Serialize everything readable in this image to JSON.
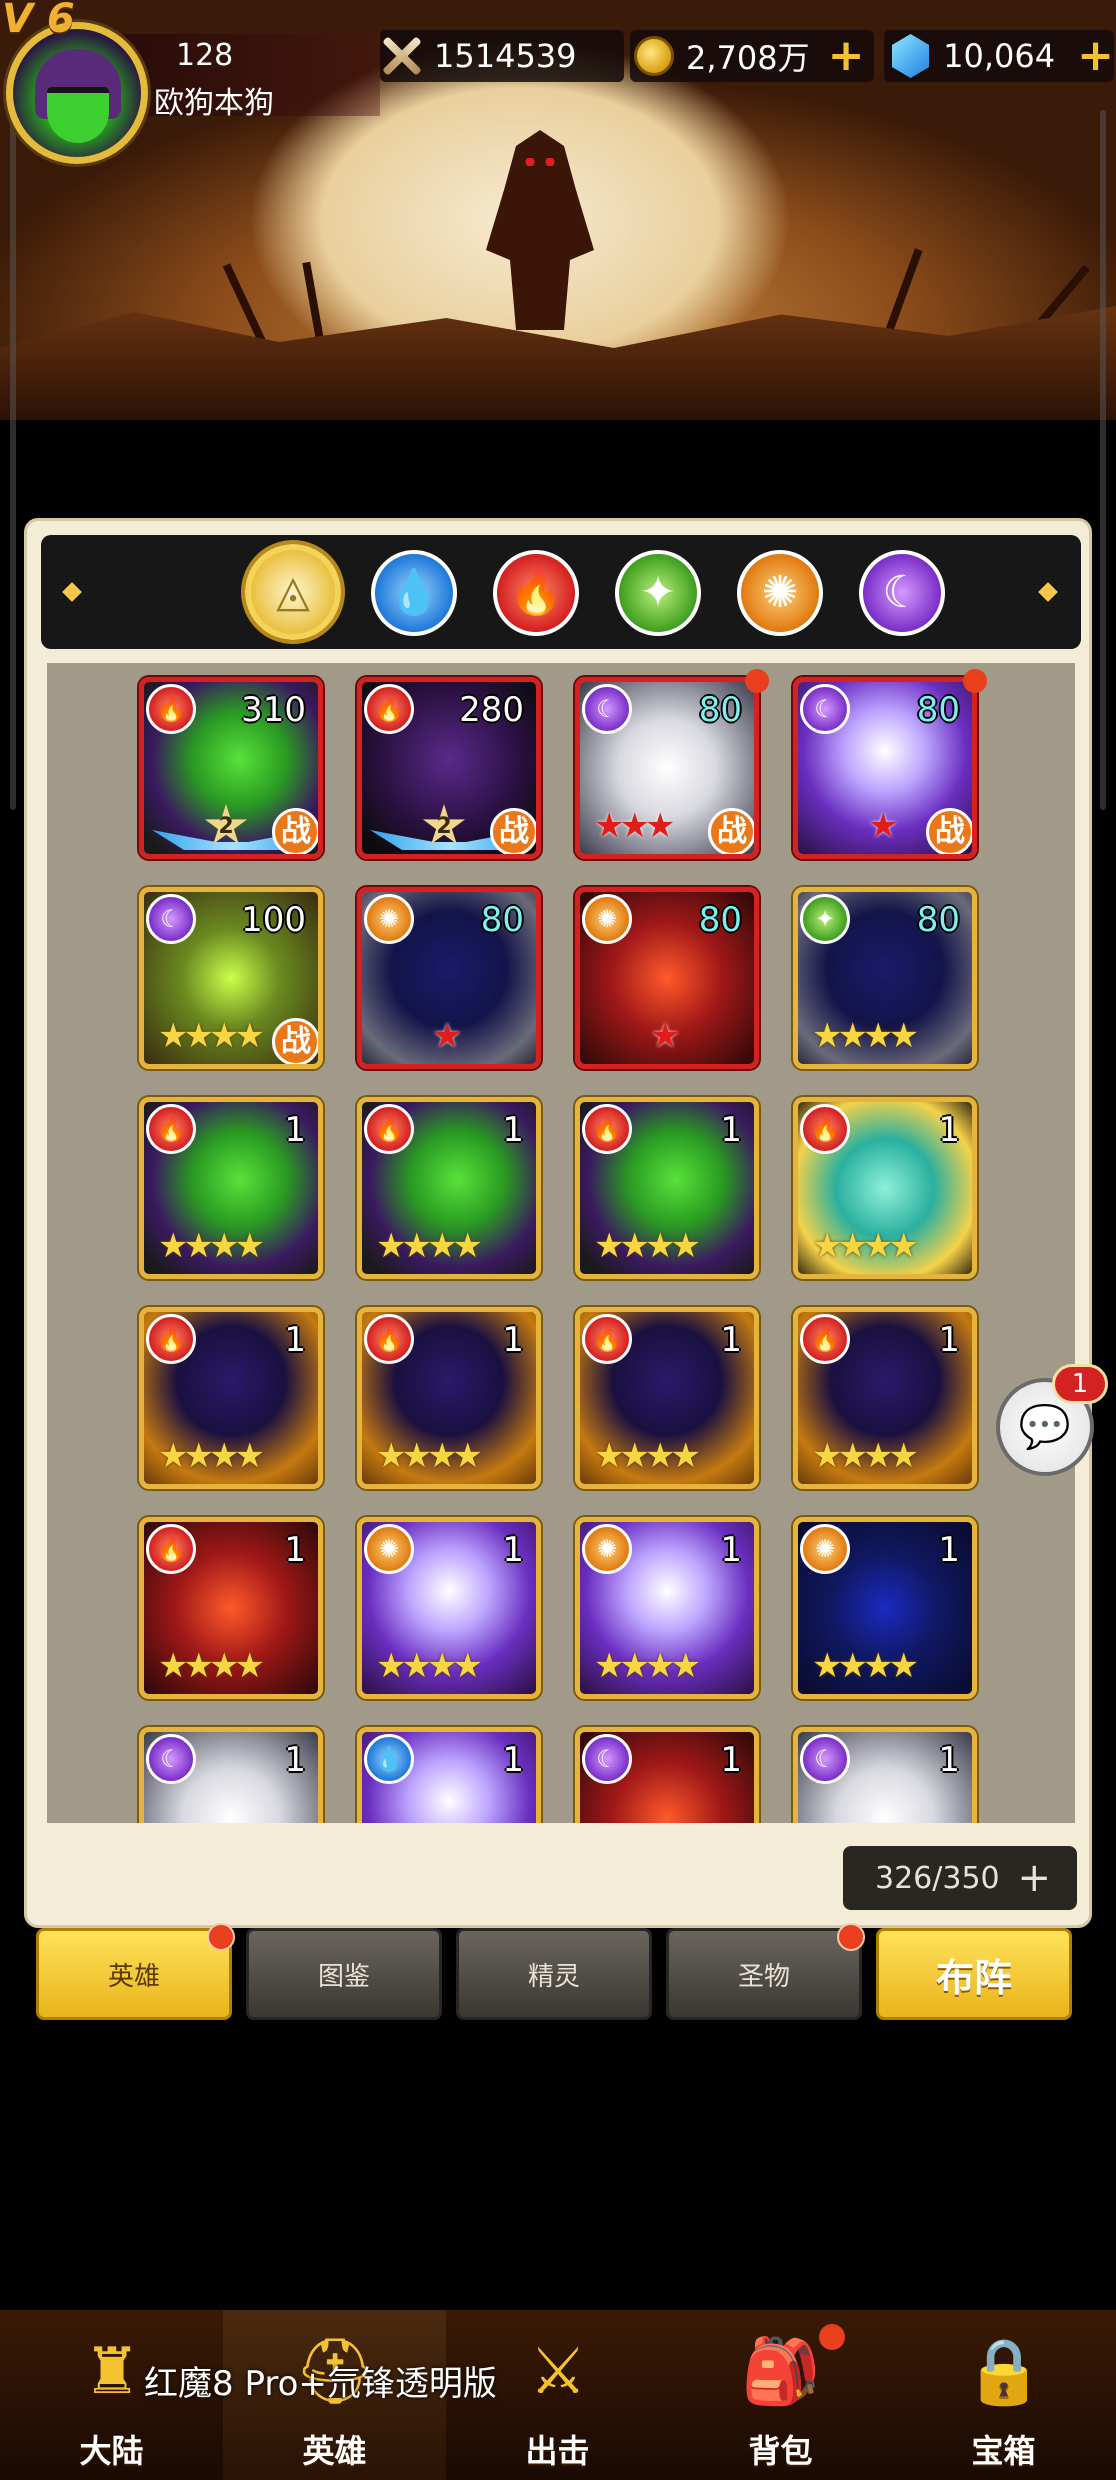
{
  "top_bar": {
    "vip_label": "V 6",
    "level": "128",
    "player_name": "欧狗本狗",
    "power": "1514539",
    "gold": "2,708万",
    "gems": "10,064",
    "plus_symbol": "+"
  },
  "element_filters": [
    {
      "name": "all",
      "icon": "◬",
      "selected": true
    },
    {
      "name": "water",
      "icon": "💧",
      "selected": false
    },
    {
      "name": "fire",
      "icon": "🔥",
      "selected": false
    },
    {
      "name": "wind",
      "icon": "✦",
      "selected": false
    },
    {
      "name": "sun",
      "icon": "✺",
      "selected": false
    },
    {
      "name": "moon",
      "icon": "☾",
      "selected": false
    }
  ],
  "element_icons": {
    "fire": "🔥",
    "moon": "☾",
    "sun": "✺",
    "wind": "✦",
    "water": "💧"
  },
  "heroes": [
    {
      "element": "fire",
      "level": "310",
      "stars": 2,
      "star_style": "rank",
      "in_battle": true,
      "frame": "red",
      "art": "g-green",
      "red_dot": false
    },
    {
      "element": "fire",
      "level": "280",
      "stars": 2,
      "star_style": "rank",
      "in_battle": true,
      "frame": "red",
      "art": "g-black",
      "red_dot": false
    },
    {
      "element": "moon",
      "level": "80",
      "stars": 3,
      "star_style": "red",
      "in_battle": true,
      "frame": "red",
      "art": "g-white",
      "red_dot": true
    },
    {
      "element": "moon",
      "level": "80",
      "stars": 1,
      "star_style": "red",
      "in_battle": true,
      "frame": "red",
      "art": "g-purple",
      "red_dot": true
    },
    {
      "element": "moon",
      "level": "100",
      "stars": 4,
      "star_style": "gold",
      "in_battle": true,
      "frame": "gold",
      "art": "g-yellowgreen",
      "red_dot": false
    },
    {
      "element": "sun",
      "level": "80",
      "stars": 1,
      "star_style": "red",
      "in_battle": false,
      "frame": "red",
      "art": "g-navy",
      "red_dot": false
    },
    {
      "element": "sun",
      "level": "80",
      "stars": 1,
      "star_style": "red",
      "in_battle": false,
      "frame": "red",
      "art": "g-red",
      "red_dot": false
    },
    {
      "element": "wind",
      "level": "80",
      "stars": 4,
      "star_style": "gold",
      "in_battle": false,
      "frame": "gold",
      "art": "g-navy",
      "red_dot": false
    },
    {
      "element": "fire",
      "level": "1",
      "stars": 4,
      "star_style": "gold",
      "in_battle": false,
      "frame": "gold",
      "art": "g-green",
      "red_dot": false
    },
    {
      "element": "fire",
      "level": "1",
      "stars": 4,
      "star_style": "gold",
      "in_battle": false,
      "frame": "gold",
      "art": "g-green",
      "red_dot": false
    },
    {
      "element": "fire",
      "level": "1",
      "stars": 4,
      "star_style": "gold",
      "in_battle": false,
      "frame": "gold",
      "art": "g-green",
      "red_dot": false
    },
    {
      "element": "fire",
      "level": "1",
      "stars": 4,
      "star_style": "gold",
      "in_battle": false,
      "frame": "gold",
      "art": "g-teal",
      "red_dot": false
    },
    {
      "element": "fire",
      "level": "1",
      "stars": 4,
      "star_style": "gold",
      "in_battle": false,
      "frame": "gold",
      "art": "g-orange",
      "red_dot": false
    },
    {
      "element": "fire",
      "level": "1",
      "stars": 4,
      "star_style": "gold",
      "in_battle": false,
      "frame": "gold",
      "art": "g-orange",
      "red_dot": false
    },
    {
      "element": "fire",
      "level": "1",
      "stars": 4,
      "star_style": "gold",
      "in_battle": false,
      "frame": "gold",
      "art": "g-orange",
      "red_dot": false
    },
    {
      "element": "fire",
      "level": "1",
      "stars": 4,
      "star_style": "gold",
      "in_battle": false,
      "frame": "gold",
      "art": "g-orange",
      "red_dot": false
    },
    {
      "element": "fire",
      "level": "1",
      "stars": 4,
      "star_style": "gold",
      "in_battle": false,
      "frame": "gold",
      "art": "g-red",
      "red_dot": false
    },
    {
      "element": "sun",
      "level": "1",
      "stars": 4,
      "star_style": "gold",
      "in_battle": false,
      "frame": "gold",
      "art": "g-purple",
      "red_dot": false
    },
    {
      "element": "sun",
      "level": "1",
      "stars": 4,
      "star_style": "gold",
      "in_battle": false,
      "frame": "gold",
      "art": "g-purple",
      "red_dot": false
    },
    {
      "element": "sun",
      "level": "1",
      "stars": 4,
      "star_style": "gold",
      "in_battle": false,
      "frame": "gold",
      "art": "g-blue",
      "red_dot": false
    },
    {
      "element": "moon",
      "level": "1",
      "stars": 0,
      "star_style": "gold",
      "in_battle": false,
      "frame": "gold",
      "art": "g-white",
      "red_dot": false
    },
    {
      "element": "water",
      "level": "1",
      "stars": 0,
      "star_style": "gold",
      "in_battle": false,
      "frame": "gold",
      "art": "g-purple",
      "red_dot": false
    },
    {
      "element": "moon",
      "level": "1",
      "stars": 0,
      "star_style": "gold",
      "in_battle": false,
      "frame": "gold",
      "art": "g-red",
      "red_dot": false
    },
    {
      "element": "moon",
      "level": "1",
      "stars": 0,
      "star_style": "gold",
      "in_battle": false,
      "frame": "gold",
      "art": "g-white",
      "red_dot": false
    }
  ],
  "battle_label": "战",
  "hero_count": "326/350",
  "hero_count_plus": "+",
  "chat_badge": "1",
  "chat_icon": "💬",
  "sub_tabs": {
    "heroes": "英雄",
    "codex": "图鉴",
    "spirits": "精灵",
    "relics": "圣物",
    "lineup": "布阵"
  },
  "bottom_nav": [
    {
      "label": "大陆",
      "icon": "♜",
      "dot": false
    },
    {
      "label": "英雄",
      "icon": "⛑",
      "dot": false
    },
    {
      "label": "出击",
      "icon": "⚔",
      "dot": false
    },
    {
      "label": "背包",
      "icon": "🎒",
      "dot": true
    },
    {
      "label": "宝箱",
      "icon": "🔒",
      "dot": false
    }
  ],
  "watermark": "红魔8 Pro+氘锋透明版",
  "colors": {
    "accent_gold": "#f2c230",
    "badge_red": "#e8401c",
    "panel_bg": "#f3ecd6"
  }
}
